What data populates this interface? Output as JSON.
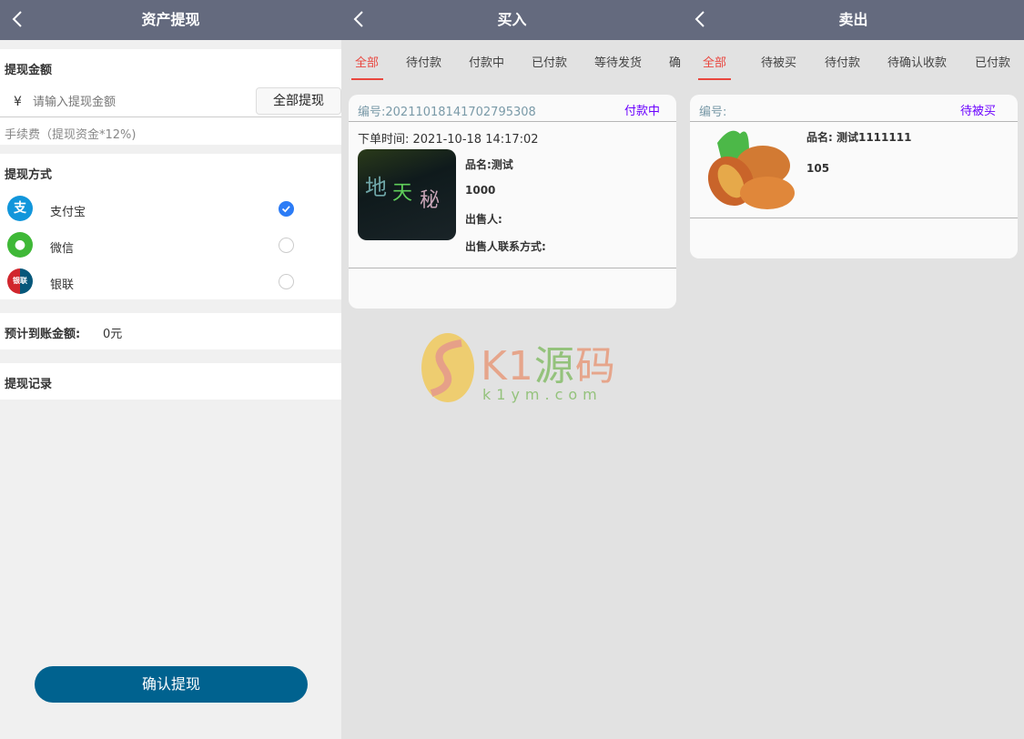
{
  "withdraw": {
    "title": "资产提现",
    "amount_label": "提现金额",
    "currency_symbol": "¥",
    "amount_placeholder": "请输入提现金额",
    "amount_value": "",
    "withdraw_all": "全部提现",
    "fee_note": "手续费（提现资金*12%)",
    "method_label": "提现方式",
    "methods": [
      {
        "name": "支付宝",
        "icon": "alipay-icon",
        "selected": true,
        "color": "#1296db"
      },
      {
        "name": "微信",
        "icon": "wechat-icon",
        "selected": false,
        "color": "#3fb837"
      },
      {
        "name": "银联",
        "icon": "unionpay-icon",
        "selected": false,
        "color": "#d1262d"
      }
    ],
    "expected_label": "预计到账金额:",
    "expected_value": "0元",
    "records_label": "提现记录",
    "confirm": "确认提现"
  },
  "buy": {
    "title": "买入",
    "tabs": [
      "全部",
      "待付款",
      "付款中",
      "已付款",
      "等待发货",
      "确"
    ],
    "order": {
      "id_label": "编号:20211018141702795308",
      "status": "付款中",
      "time": "下单时间: 2021-10-18 14:17:02",
      "product": "品名:测试",
      "price": "1000",
      "seller": "出售人:",
      "seller_contact": "出售人联系方式:"
    }
  },
  "sell": {
    "title": "卖出",
    "tabs": [
      "全部",
      "待被买",
      "待付款",
      "待确认收款",
      "已付款"
    ],
    "order": {
      "id_label": "编号:",
      "status": "待被买",
      "product": "品名: 测试1111111",
      "price": "105"
    }
  },
  "watermark": {
    "brand": "K1源码",
    "url": "k1ym.com"
  },
  "colors": {
    "header": "#646a7e",
    "accent": "#e9473f",
    "status": "#6a00ff",
    "confirm": "#00628f"
  }
}
